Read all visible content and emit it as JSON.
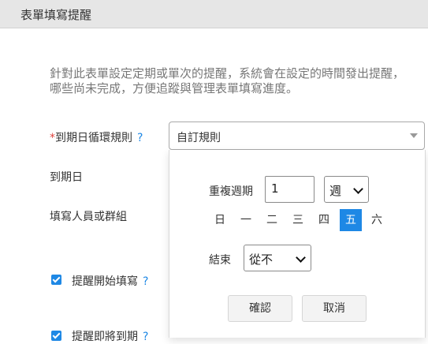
{
  "header": {
    "title": "表單填寫提醒"
  },
  "description": {
    "line1": "針對此表單設定定期或單次的提醒，系統會在設定的時間發出提醒，",
    "line2": "哪些尚未完成，方便追蹤與管理表單填寫進度。"
  },
  "form": {
    "due_rule_required": "*",
    "due_rule_label": "到期日循環規則",
    "help_symbol": "?",
    "due_rule_value": "自訂規則",
    "due_date_label": "到期日",
    "assignee_label": "填寫人員或群組",
    "remind_start_label": "提醒開始填寫",
    "remind_due_label": "提醒即將到期"
  },
  "popup": {
    "repeat_label": "重複週期",
    "repeat_value": "1",
    "period_value": "週",
    "weekdays": [
      "日",
      "一",
      "二",
      "三",
      "四",
      "五",
      "六"
    ],
    "selected_weekday": "五",
    "end_label": "結束",
    "end_value": "從不",
    "confirm_label": "確認",
    "cancel_label": "取消"
  },
  "colors": {
    "accent": "#1e88e5",
    "required": "#e0443e"
  }
}
